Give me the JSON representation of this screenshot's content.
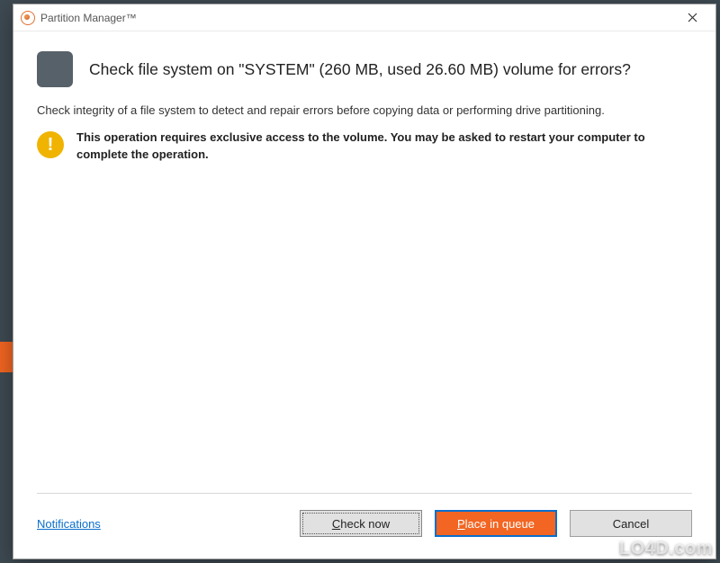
{
  "window": {
    "title": "Partition Manager™"
  },
  "dialog": {
    "heading": "Check file system on \"SYSTEM\" (260 MB, used 26.60 MB) volume for errors?",
    "description": "Check integrity of a file system to detect and repair errors before copying data or performing drive partitioning.",
    "warning": "This operation requires exclusive access to the volume. You may be asked to restart your computer to complete the operation."
  },
  "footer": {
    "notifications_label": "Notifications",
    "check_now_prefix": "C",
    "check_now_rest": "heck now",
    "place_prefix": "P",
    "place_rest": "lace in queue",
    "cancel_label": "Cancel"
  },
  "watermark": {
    "text": "LO4D.com"
  },
  "colors": {
    "accent": "#f26522",
    "warning": "#f0b400",
    "link": "#0a6ecc"
  }
}
